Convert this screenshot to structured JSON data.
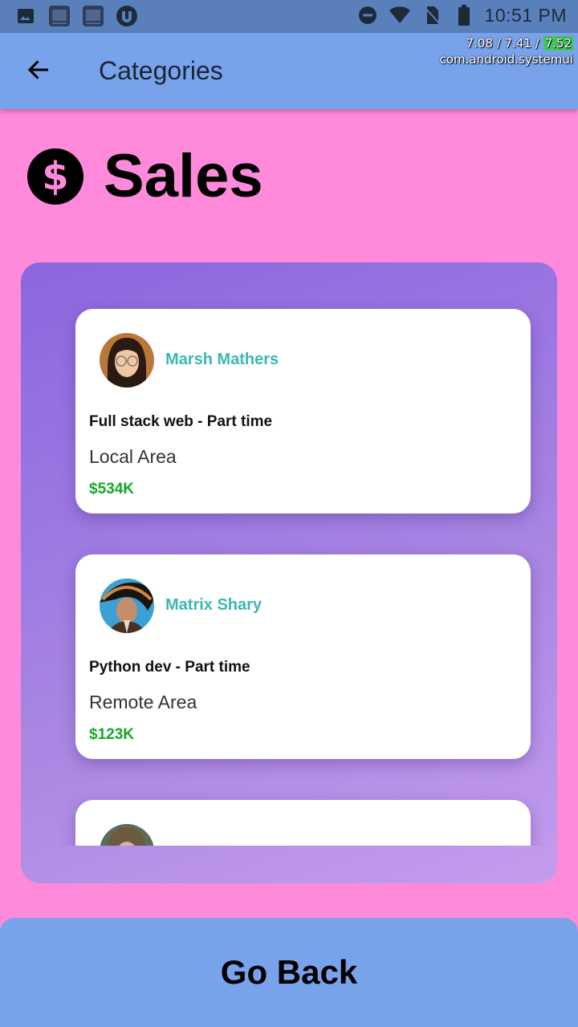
{
  "status_bar": {
    "time": "10:51 PM",
    "left_icons": [
      "image-icon",
      "bible-app-icon",
      "bible-app-icon",
      "utorrent-icon"
    ],
    "right_icons": [
      "do-not-disturb-icon",
      "wifi-icon",
      "no-sim-icon",
      "battery-icon"
    ]
  },
  "debug_overlay": {
    "line1_a": "7.08 / 7.41 / ",
    "line1_b": "7.52",
    "line2": "com.android.systemui"
  },
  "app_bar": {
    "title": "Categories",
    "back_icon": "arrow-back-icon"
  },
  "header": {
    "title": "Sales",
    "icon": "dollar-circle-icon"
  },
  "listings": [
    {
      "name": "Marsh Mathers",
      "job": "Full stack web - Part time",
      "area": "Local Area",
      "salary": "$534K"
    },
    {
      "name": "Matrix Shary",
      "job": "Python dev - Part time",
      "area": "Remote Area",
      "salary": "$123K"
    },
    {
      "name": "",
      "job": "",
      "area": "",
      "salary": ""
    }
  ],
  "footer": {
    "button_label": "Go Back"
  },
  "colors": {
    "background": "#FF8ADB",
    "app_bar": "#78A2EA",
    "name_accent": "#3CB8B0",
    "salary": "#16A82A"
  }
}
